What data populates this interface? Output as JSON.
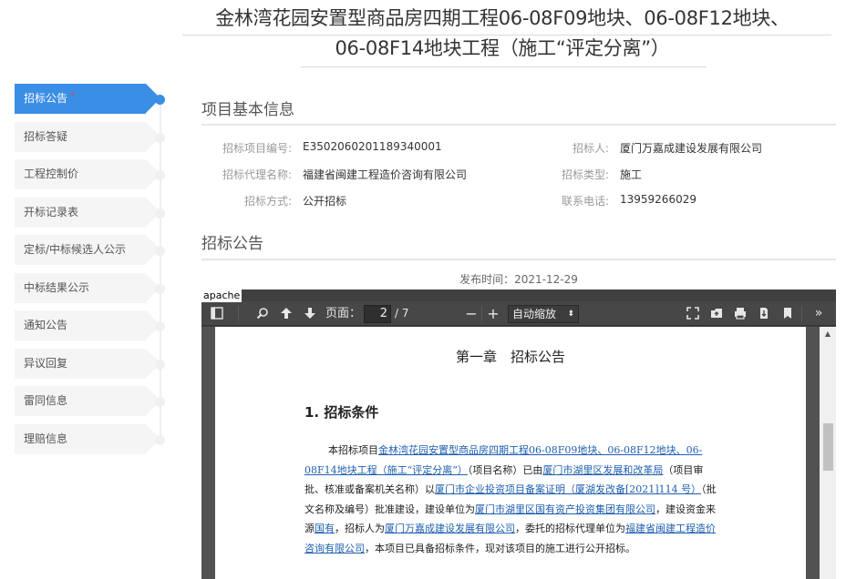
{
  "page": {
    "title_line1": "金林湾花园安置型商品房四期工程06-08F09地块、06-08F12地块、",
    "title_line2": "06-08F14地块工程（施工“评定分离”）"
  },
  "nav": {
    "items": [
      {
        "label": "招标公告",
        "required": "*"
      },
      {
        "label": "招标答疑"
      },
      {
        "label": "工程控制价"
      },
      {
        "label": "开标记录表"
      },
      {
        "label": "定标/中标候选人公示"
      },
      {
        "label": "中标结果公示"
      },
      {
        "label": "通知公告"
      },
      {
        "label": "异议回复"
      },
      {
        "label": "雷同信息"
      },
      {
        "label": "理赔信息"
      }
    ]
  },
  "info": {
    "section_title": "项目基本信息",
    "fields": [
      {
        "label": "招标项目编号:",
        "value": "E3502060201189340001"
      },
      {
        "label": "招标人:",
        "value": "厦门万嘉成建设发展有限公司"
      },
      {
        "label": "招标代理名称:",
        "value": "福建省闽建工程造价咨询有限公司"
      },
      {
        "label": "招标类型:",
        "value": "施工"
      },
      {
        "label": "招标方式:",
        "value": "公开招标"
      },
      {
        "label": "联系电话:",
        "value": "13959266029"
      }
    ]
  },
  "announcement": {
    "section_title": "招标公告",
    "publish_label": "发布时间：",
    "publish_date": "2021-12-29"
  },
  "viewer": {
    "frame_label": "apache",
    "page_label": "页面：",
    "current_page": "2",
    "page_total": "/ 7",
    "zoom_label": "自动缩放",
    "zoom_out": "−",
    "zoom_in": "+"
  },
  "document": {
    "chapter": "第一章　招标公告",
    "heading": "1. 招标条件",
    "p1": "本招标项目",
    "project_name": "金林湾花园安置型商品房四期工程06-08F09地块、06-08F12地块、06-08F14地块工程（施工“评定分离”）",
    "p2": "（项目名称）已由",
    "approver": "厦门市湖里区发展和改革局",
    "p3": "（项目审批、核准或备案机关名称）以",
    "approval_doc": "厦门市企业投资项目备案证明（厦湖发改备[2021]114 号）",
    "p4": "（批文名称及编号）批准建设，建设单位为",
    "builder": "厦门市湖里区国有资产投资集团有限公司",
    "p5": "，建设资金来源",
    "fund_source": "国有",
    "p6": "，招标人为",
    "tenderer": "厦门万嘉成建设发展有限公司",
    "p7": "，委托的招标代理单位为",
    "agent": "福建省闽建工程造价咨询有限公司",
    "p8": "，本项目已具备招标条件，现对该项目的施工进行公开招标。"
  },
  "colors": {
    "accent": "#3a8ee6",
    "required": "#e54545",
    "link": "#1f5fb0",
    "viewer_bg": "#404040"
  }
}
